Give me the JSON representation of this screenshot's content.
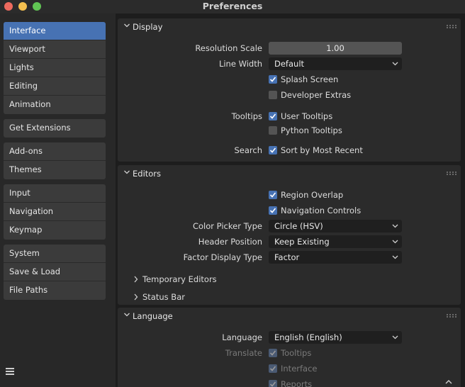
{
  "window": {
    "title": "Preferences"
  },
  "sidebar": {
    "groups": [
      [
        "Interface",
        "Viewport",
        "Lights",
        "Editing",
        "Animation"
      ],
      [
        "Get Extensions"
      ],
      [
        "Add-ons",
        "Themes"
      ],
      [
        "Input",
        "Navigation",
        "Keymap"
      ],
      [
        "System",
        "Save & Load",
        "File Paths"
      ]
    ],
    "active": "Interface"
  },
  "display": {
    "title": "Display",
    "resolution_scale_label": "Resolution Scale",
    "resolution_scale_value": "1.00",
    "line_width_label": "Line Width",
    "line_width_value": "Default",
    "splash_screen": "Splash Screen",
    "developer_extras": "Developer Extras",
    "tooltips_label": "Tooltips",
    "user_tooltips": "User Tooltips",
    "python_tooltips": "Python Tooltips",
    "search_label": "Search",
    "sort_recent": "Sort by Most Recent"
  },
  "editors": {
    "title": "Editors",
    "region_overlap": "Region Overlap",
    "navigation_controls": "Navigation Controls",
    "color_picker_label": "Color Picker Type",
    "color_picker_value": "Circle (HSV)",
    "header_position_label": "Header Position",
    "header_position_value": "Keep Existing",
    "factor_display_label": "Factor Display Type",
    "factor_display_value": "Factor",
    "temporary_editors": "Temporary Editors",
    "status_bar": "Status Bar"
  },
  "language": {
    "title": "Language",
    "language_label": "Language",
    "language_value": "English (English)",
    "translate_label": "Translate",
    "tooltips": "Tooltips",
    "interface": "Interface",
    "reports": "Reports"
  },
  "states": {
    "splash_screen": true,
    "developer_extras": false,
    "user_tooltips": true,
    "python_tooltips": false,
    "sort_recent": true,
    "region_overlap": true,
    "navigation_controls": true,
    "translate_tooltips": true,
    "translate_interface": true,
    "translate_reports": true
  },
  "colors": {
    "accent": "#4772b3",
    "panel": "#2b2b2b",
    "background": "#1d1d1d"
  }
}
